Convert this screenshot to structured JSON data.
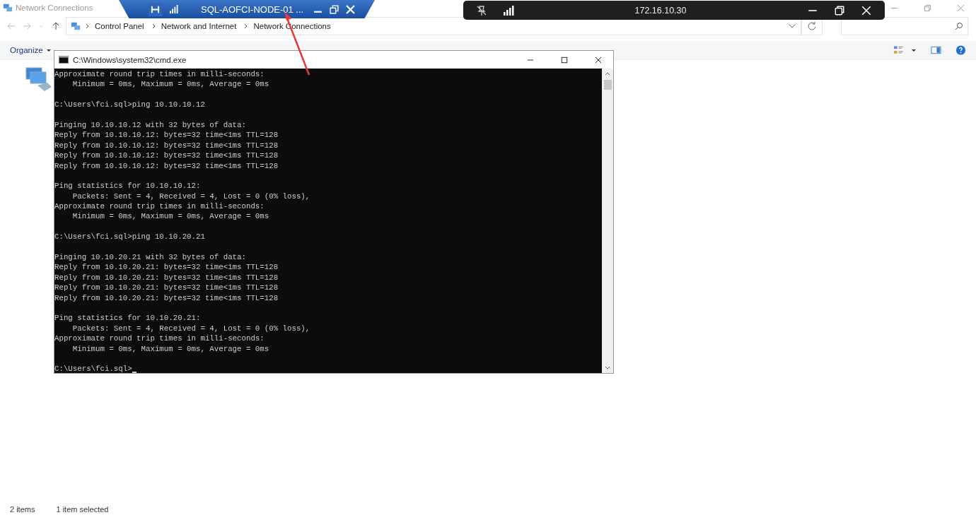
{
  "explorer": {
    "title": "Network Connections",
    "breadcrumbs": [
      "Control Panel",
      "Network and Internet",
      "Network Connections"
    ],
    "organize": "Organize",
    "status": [
      "2 items",
      "1 item selected"
    ]
  },
  "rdp_bar_blue": {
    "title": "SQL-AOFCI-NODE-01 ..."
  },
  "rdp_bar_dark": {
    "title": "172.16.10.30"
  },
  "cmd": {
    "title": "C:\\Windows\\system32\\cmd.exe",
    "caret": true,
    "blocks": [
      [
        "Approximate round trip times in milli-seconds:",
        "    Minimum = 0ms, Maximum = 0ms, Average = 0ms"
      ],
      [
        "C:\\Users\\fci.sql>ping 10.10.10.12"
      ],
      [
        "Pinging 10.10.10.12 with 32 bytes of data:",
        "Reply from 10.10.10.12: bytes=32 time<1ms TTL=128",
        "Reply from 10.10.10.12: bytes=32 time<1ms TTL=128",
        "Reply from 10.10.10.12: bytes=32 time<1ms TTL=128",
        "Reply from 10.10.10.12: bytes=32 time<1ms TTL=128"
      ],
      [
        "Ping statistics for 10.10.10.12:",
        "    Packets: Sent = 4, Received = 4, Lost = 0 (0% loss),",
        "Approximate round trip times in milli-seconds:",
        "    Minimum = 0ms, Maximum = 0ms, Average = 0ms"
      ],
      [
        "C:\\Users\\fci.sql>ping 10.10.20.21"
      ],
      [
        "Pinging 10.10.20.21 with 32 bytes of data:",
        "Reply from 10.10.20.21: bytes=32 time<1ms TTL=128",
        "Reply from 10.10.20.21: bytes=32 time<1ms TTL=128",
        "Reply from 10.10.20.21: bytes=32 time<1ms TTL=128",
        "Reply from 10.10.20.21: bytes=32 time<1ms TTL=128"
      ],
      [
        "Ping statistics for 10.10.20.21:",
        "    Packets: Sent = 4, Received = 4, Lost = 0 (0% loss),",
        "Approximate round trip times in milli-seconds:",
        "    Minimum = 0ms, Maximum = 0ms, Average = 0ms"
      ],
      [
        "C:\\Users\\fci.sql>"
      ]
    ]
  }
}
